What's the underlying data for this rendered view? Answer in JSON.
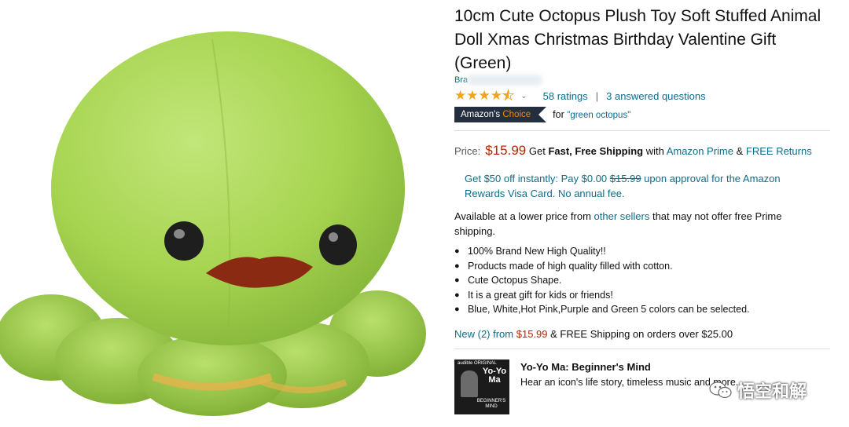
{
  "product": {
    "title": "10cm Cute Octopus Plush Toy Soft Stuffed Animal Doll Xmas Christmas Birthday Valentine Gift (Green)",
    "brand_partial": "Bra",
    "ratings": "58 ratings",
    "separator": "|",
    "questions": "3 answered questions",
    "star_rating": 4.5,
    "badge_prefix": "Amazon's",
    "badge_suffix": "Choice",
    "choice_for": "for",
    "choice_query": "\"green octopus\""
  },
  "price": {
    "label": "Price:",
    "value": "$15.99",
    "get": "Get",
    "fast": "Fast, Free Shipping",
    "with": "with",
    "prime": "Amazon Prime",
    "amp": "&",
    "returns": "FREE Returns"
  },
  "offer": {
    "part1": "Get $50 off instantly: Pay $0.00",
    "strike": "$15.99",
    "part2": "upon approval for the Amazon Rewards Visa Card. No annual fee."
  },
  "availability": {
    "part1": "Available at a lower price from",
    "link": "other sellers",
    "part2": "that may not offer free Prime shipping."
  },
  "bullets": [
    "100% Brand New High Quality!!",
    "Products made of high quality filled with cotton.",
    "Cute Octopus Shape.",
    "It is a great gift for kids or friends!",
    "Blue, White,Hot Pink,Purple and Green 5 colors can be selected."
  ],
  "new_offers": {
    "link": "New (2) from",
    "price": "$15.99",
    "rest": "& FREE Shipping on orders over $25.00"
  },
  "audible": {
    "cover_top": "audible ORIGINAL",
    "cover_name": "Yo-Yo Ma",
    "cover_bottom": "BEGINNER'S MIND",
    "title": "Yo-Yo Ma: Beginner's Mind",
    "subtitle": "Hear an icon's life story, timeless music and more."
  },
  "watermark": {
    "text": "悟空和解"
  },
  "colors": {
    "link": "#0f6c8a",
    "price": "#b12704",
    "star": "#f0a41a",
    "badge_bg": "#232f3e",
    "badge_accent": "#f08804"
  }
}
